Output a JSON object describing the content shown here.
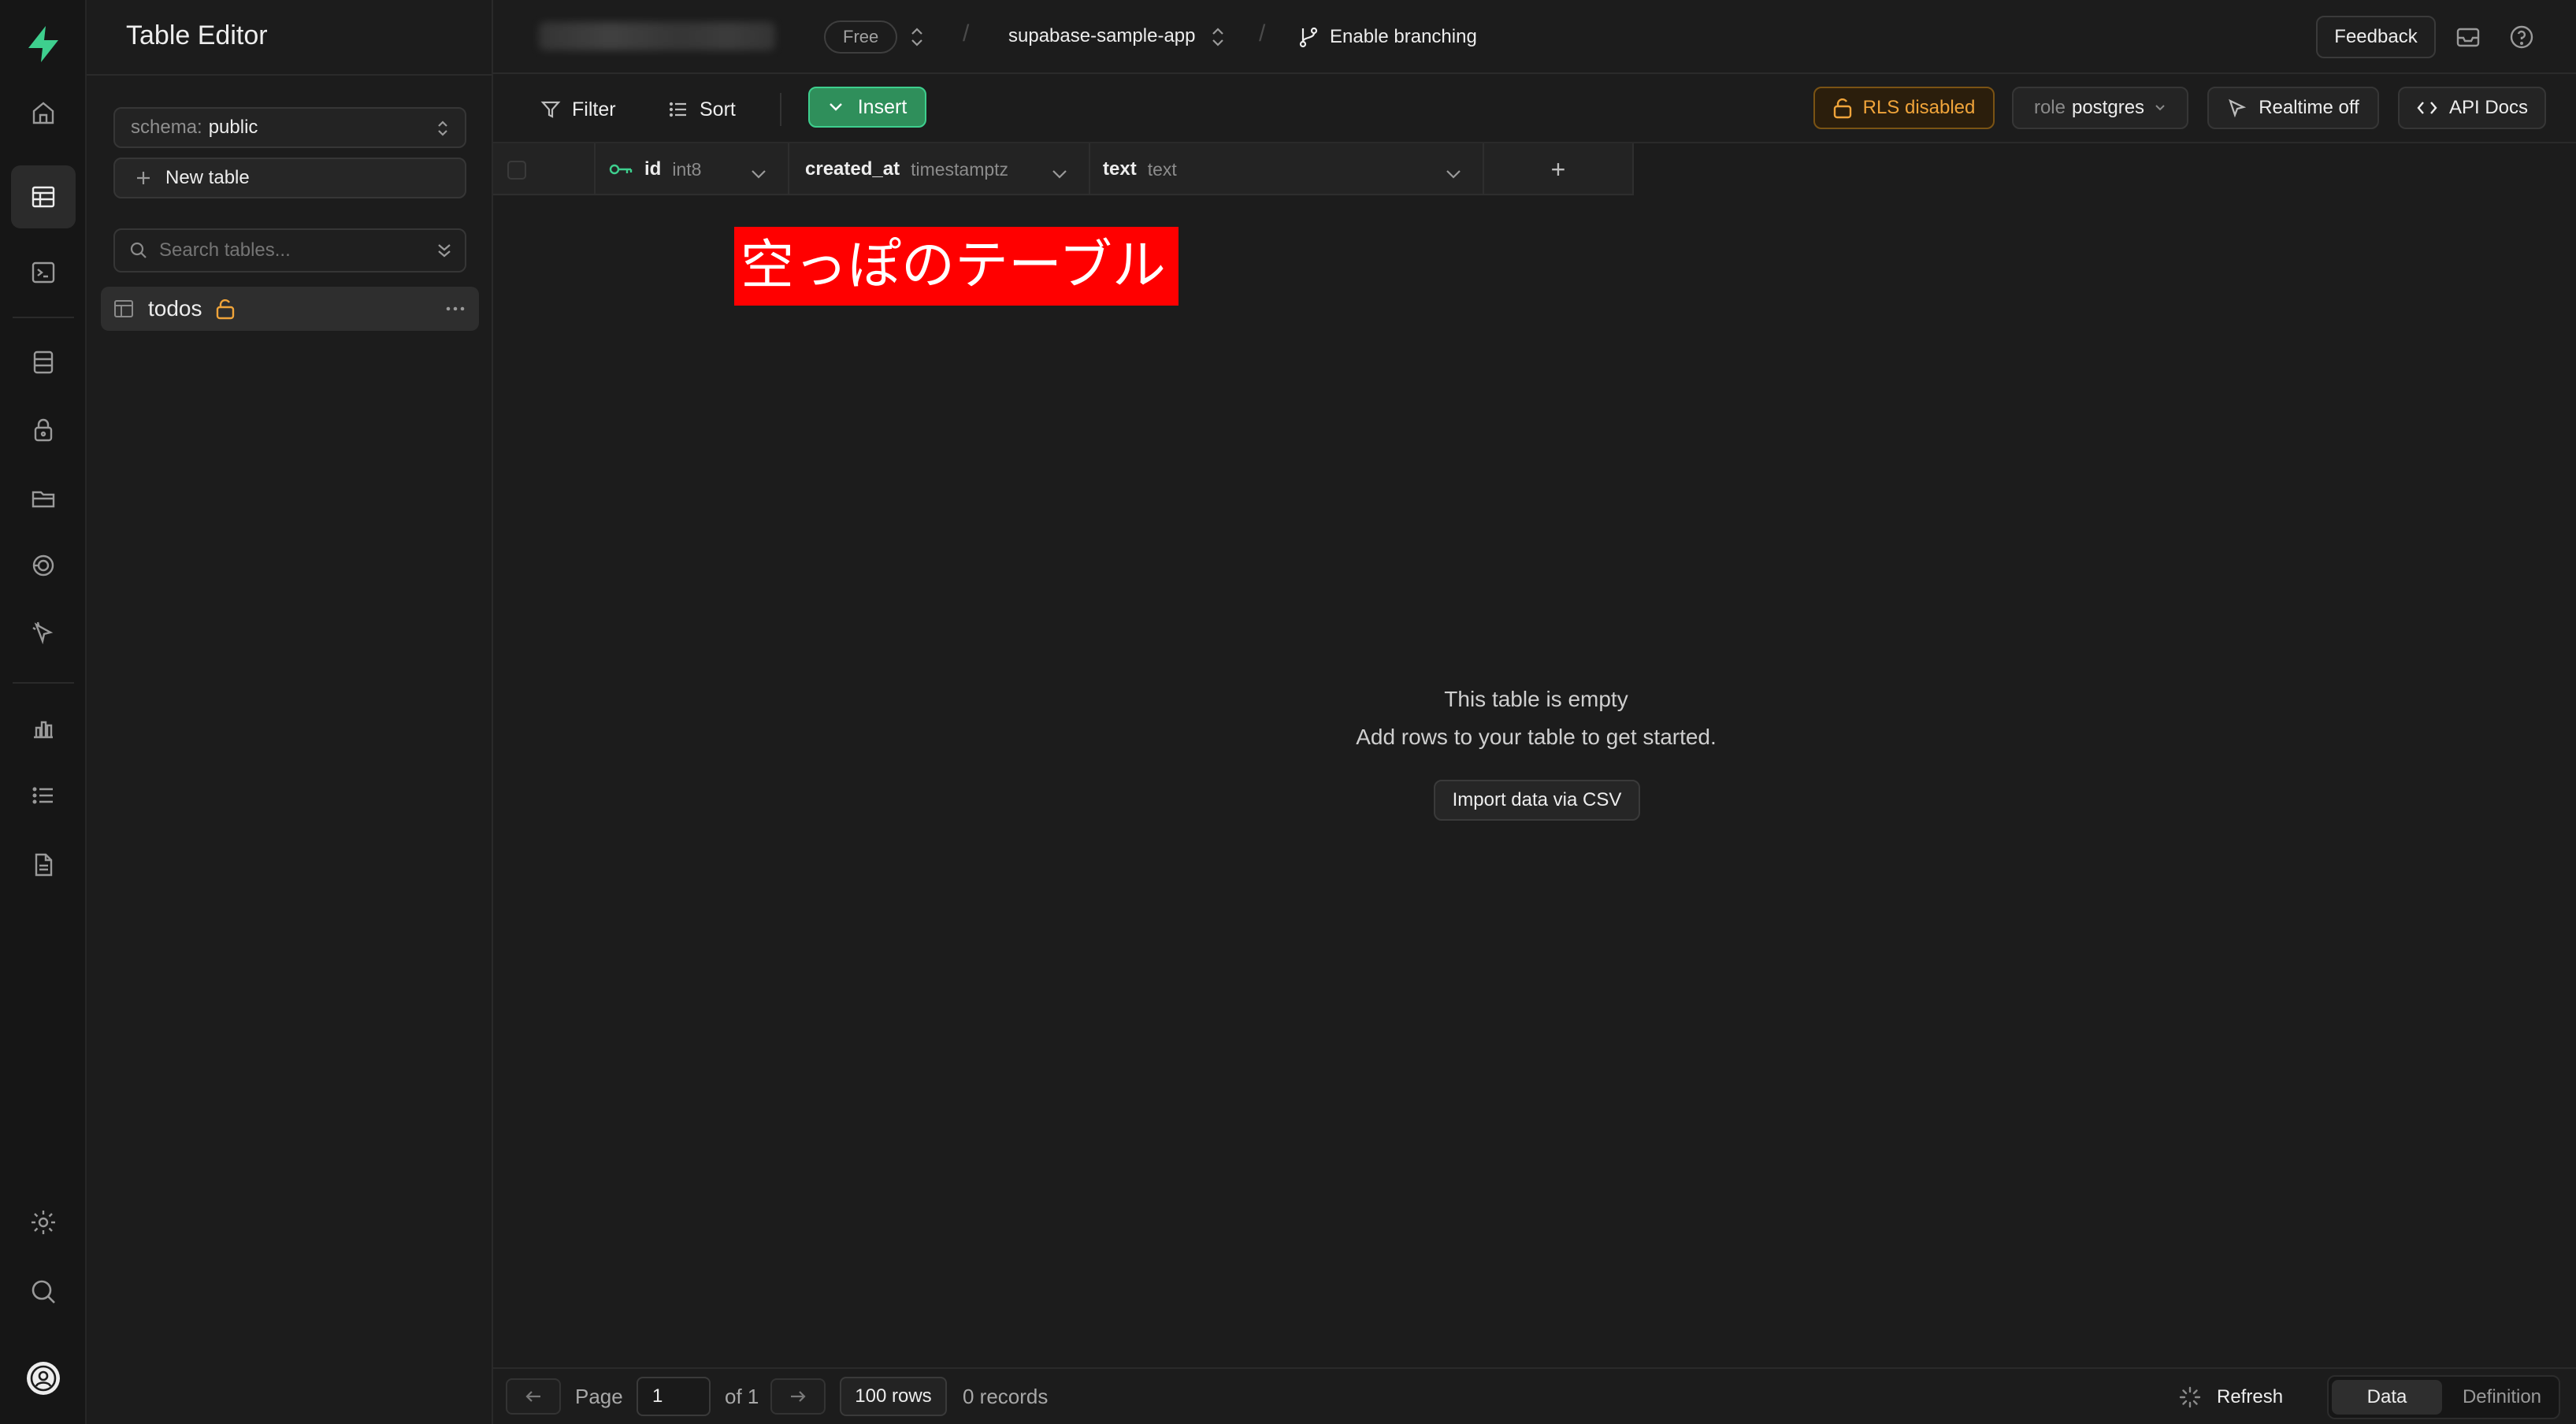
{
  "colors": {
    "brand_green": "#3ecf8e",
    "insert_bg": "#2f8f5b",
    "rls_warning": "#f0a43a",
    "annotation_red": "#ff0000"
  },
  "rail": {
    "items": [
      {
        "icon": "supabase-logo-icon"
      },
      {
        "icon": "home-icon"
      },
      {
        "icon": "table-editor-icon",
        "active": true
      },
      {
        "icon": "sql-editor-icon"
      },
      {
        "icon": "database-icon"
      },
      {
        "icon": "auth-lock-icon"
      },
      {
        "icon": "storage-icon"
      },
      {
        "icon": "edge-functions-icon"
      },
      {
        "icon": "realtime-icon"
      },
      {
        "icon": "reports-icon"
      },
      {
        "icon": "logs-icon"
      },
      {
        "icon": "api-docs-icon"
      },
      {
        "icon": "settings-icon"
      },
      {
        "icon": "search-icon"
      },
      {
        "icon": "account-avatar-icon"
      }
    ]
  },
  "panel": {
    "title": "Table Editor",
    "schema_key": "schema:",
    "schema_value": "public",
    "new_table_label": "New table",
    "search_placeholder": "Search tables...",
    "tables": [
      {
        "name": "todos",
        "rls_unlocked": true
      }
    ]
  },
  "topbar": {
    "plan_badge": "Free",
    "project_name": "supabase-sample-app",
    "branching_label": "Enable branching",
    "feedback_label": "Feedback"
  },
  "toolbar": {
    "filter_label": "Filter",
    "sort_label": "Sort",
    "insert_label": "Insert",
    "rls_label": "RLS disabled",
    "role_key": "role",
    "role_value": "postgres",
    "realtime_label": "Realtime off",
    "api_docs_label": "API Docs"
  },
  "grid": {
    "columns": [
      {
        "name": "id",
        "type": "int8",
        "primary_key": true
      },
      {
        "name": "created_at",
        "type": "timestamptz"
      },
      {
        "name": "text",
        "type": "text"
      }
    ],
    "add_column_symbol": "+"
  },
  "empty_state": {
    "title": "This table is empty",
    "subtitle": "Add rows to your table to get started.",
    "import_label": "Import data via CSV"
  },
  "annotation": {
    "text": "空っぽのテーブル"
  },
  "footer": {
    "page_label": "Page",
    "page_value": "1",
    "of_label": "of 1",
    "rows_label": "100 rows",
    "records_label": "0 records",
    "refresh_label": "Refresh",
    "view_data_label": "Data",
    "view_definition_label": "Definition"
  }
}
